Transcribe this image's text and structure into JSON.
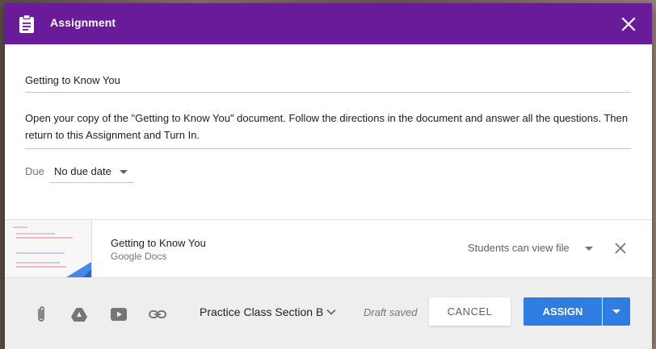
{
  "header": {
    "title": "Assignment",
    "icon": "assignment-icon",
    "close_icon": "close-icon",
    "color": "#6a1b9a"
  },
  "form": {
    "title_value": "Getting to Know You",
    "instructions_value": "Open your copy of the \"Getting to Know You\" document. Follow the directions in the document and answer all the questions. Then return to this Assignment and Turn In.",
    "due_label": "Due",
    "due_value": "No due date"
  },
  "attachment": {
    "title": "Getting to Know You",
    "type": "Google Docs",
    "permission": "Students can view file",
    "remove_icon": "close-icon"
  },
  "footer": {
    "tools": [
      "attach-file-icon",
      "google-drive-icon",
      "youtube-icon",
      "link-icon"
    ],
    "class_select": "Practice Class Section B",
    "status": "Draft saved",
    "cancel_label": "CANCEL",
    "assign_label": "ASSIGN",
    "accent_color": "#2f7de1"
  }
}
